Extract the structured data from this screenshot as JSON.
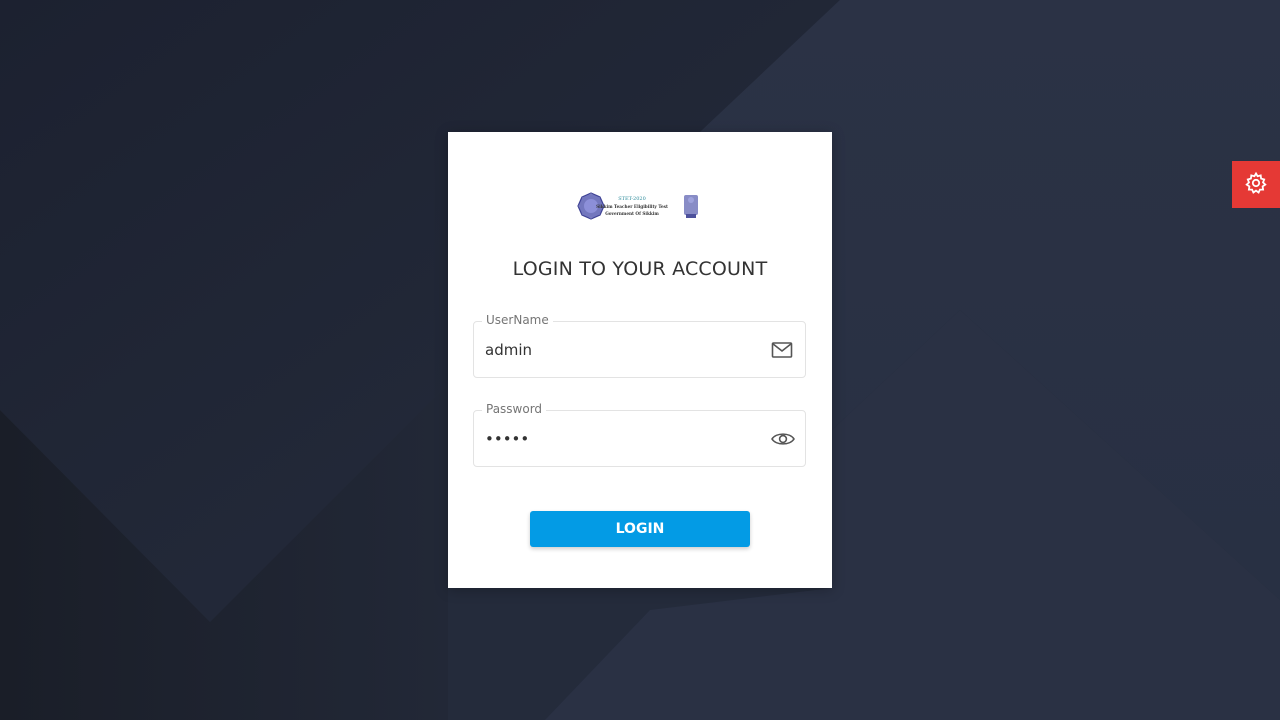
{
  "logo": {
    "line1": "STET-2020",
    "line2": "Sikkim Teacher Eligibility Test",
    "line3": "Government Of Sikkim"
  },
  "login": {
    "title": "LOGIN TO YOUR ACCOUNT",
    "username_label": "UserName",
    "username_value": "admin",
    "password_label": "Password",
    "password_value": "admin",
    "button_label": "LOGIN"
  },
  "icons": {
    "username": "mail-icon",
    "password": "eye-icon",
    "settings": "gear-icon"
  },
  "colors": {
    "background": "#232a3a",
    "card": "#ffffff",
    "primary_button": "#039be5",
    "settings_tab": "#e53935"
  }
}
